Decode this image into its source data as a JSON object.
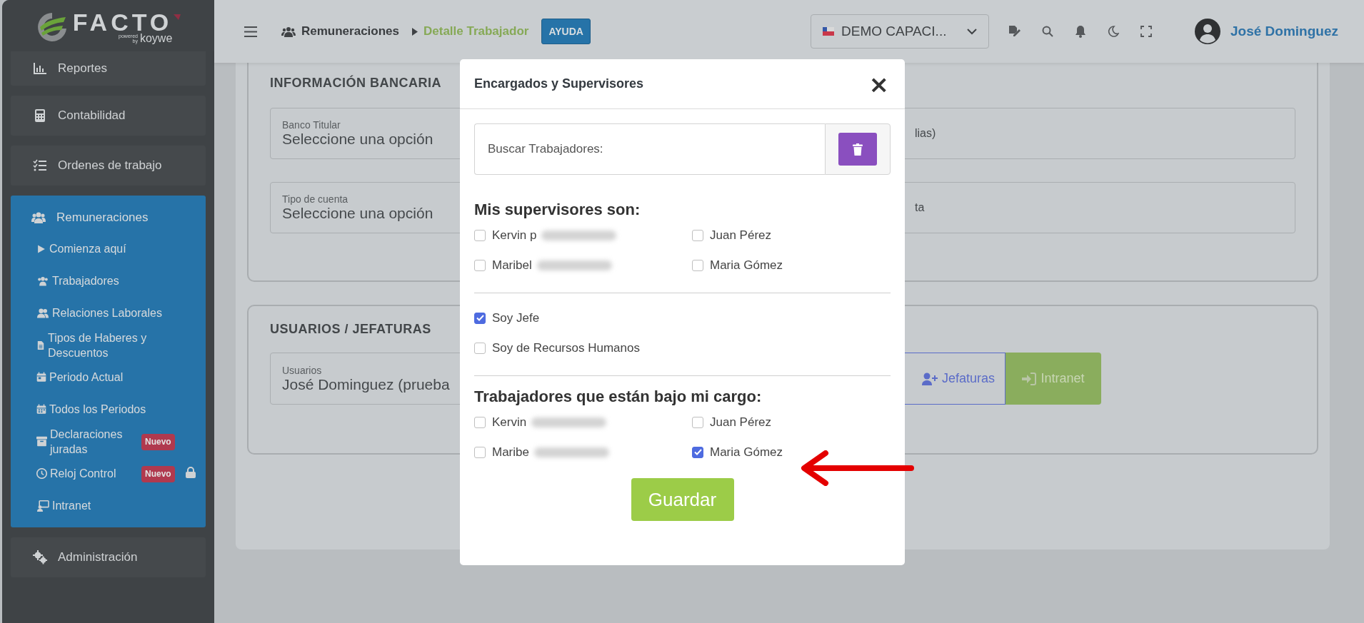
{
  "sidebar": {
    "logo": {
      "wordmark": "FACTO",
      "powered": "powered",
      "by": "by",
      "brand": "koywe"
    },
    "items": [
      {
        "label": "Reportes",
        "expanded": false
      },
      {
        "label": "Contabilidad",
        "expanded": false
      },
      {
        "label": "Ordenes de trabajo",
        "expanded": false
      },
      {
        "label": "Remuneraciones",
        "expanded": true,
        "children": [
          {
            "label": "Comienza aquí",
            "locked": false
          },
          {
            "label": "Trabajadores",
            "locked": false
          },
          {
            "label": "Relaciones Laborales",
            "locked": false
          },
          {
            "label": "Tipos de Haberes y Descuentos",
            "locked": false
          },
          {
            "label": "Periodo Actual",
            "locked": false
          },
          {
            "label": "Todos los Periodos",
            "locked": false
          },
          {
            "label": "Declaraciones juradas",
            "badge": "Nuevo",
            "locked": false
          },
          {
            "label": "Reloj Control",
            "badge": "Nuevo",
            "locked": true
          },
          {
            "label": "Intranet",
            "locked": false
          }
        ]
      },
      {
        "label": "Administración",
        "expanded": false
      }
    ]
  },
  "header": {
    "breadcrumb": [
      {
        "label": "Remuneraciones",
        "current": false
      },
      {
        "label": "Detalle Trabajador",
        "current": true
      }
    ],
    "help_button": "AYUDA",
    "company_select": {
      "value": "DEMO CAPACI..."
    },
    "user": {
      "name": "José Dominguez"
    }
  },
  "sections": [
    {
      "title": "INFORMACIÓN BANCARIA",
      "rows": [
        [
          {
            "label": "Banco Titular",
            "value": "Seleccione una opción"
          },
          {
            "value": "lias)"
          }
        ],
        [
          {
            "label": "Tipo de cuenta",
            "value": "Seleccione una opción"
          },
          {
            "value": "ta"
          }
        ]
      ]
    },
    {
      "title": "USUARIOS / JEFATURAS",
      "field": {
        "label": "Usuarios",
        "value": "José Dominguez (prueba"
      },
      "buttons": [
        {
          "label": "Jefaturas",
          "kind": "outline"
        },
        {
          "label": "Intranet",
          "kind": "solid"
        }
      ]
    }
  ],
  "modal": {
    "title": "Encargados y Supervisores",
    "close": "×",
    "search": {
      "placeholder": "Buscar Trabajadores:"
    },
    "groups": [
      {
        "heading": "Mis supervisores son:",
        "options": [
          {
            "label": "Kervin p",
            "blurred": true,
            "checked": false
          },
          {
            "label": "Juan Pérez",
            "blurred": false,
            "checked": false
          },
          {
            "label": "Maribel",
            "blurred": true,
            "checked": false
          },
          {
            "label": "Maria Gómez",
            "blurred": false,
            "checked": false
          }
        ]
      },
      {
        "options": [
          {
            "label": "Soy Jefe",
            "blurred": false,
            "checked": true
          },
          {
            "label": "Soy de Recursos Humanos",
            "blurred": false,
            "checked": false
          }
        ]
      },
      {
        "heading": "Trabajadores que están bajo mi cargo:",
        "options": [
          {
            "label": "Kervin",
            "blurred": true,
            "checked": false
          },
          {
            "label": "Juan Pérez",
            "blurred": false,
            "checked": false
          },
          {
            "label": "Maribe",
            "blurred": true,
            "checked": false
          },
          {
            "label": "Maria Gómez",
            "blurred": false,
            "checked": true
          }
        ]
      }
    ],
    "save_button": "Guardar"
  }
}
